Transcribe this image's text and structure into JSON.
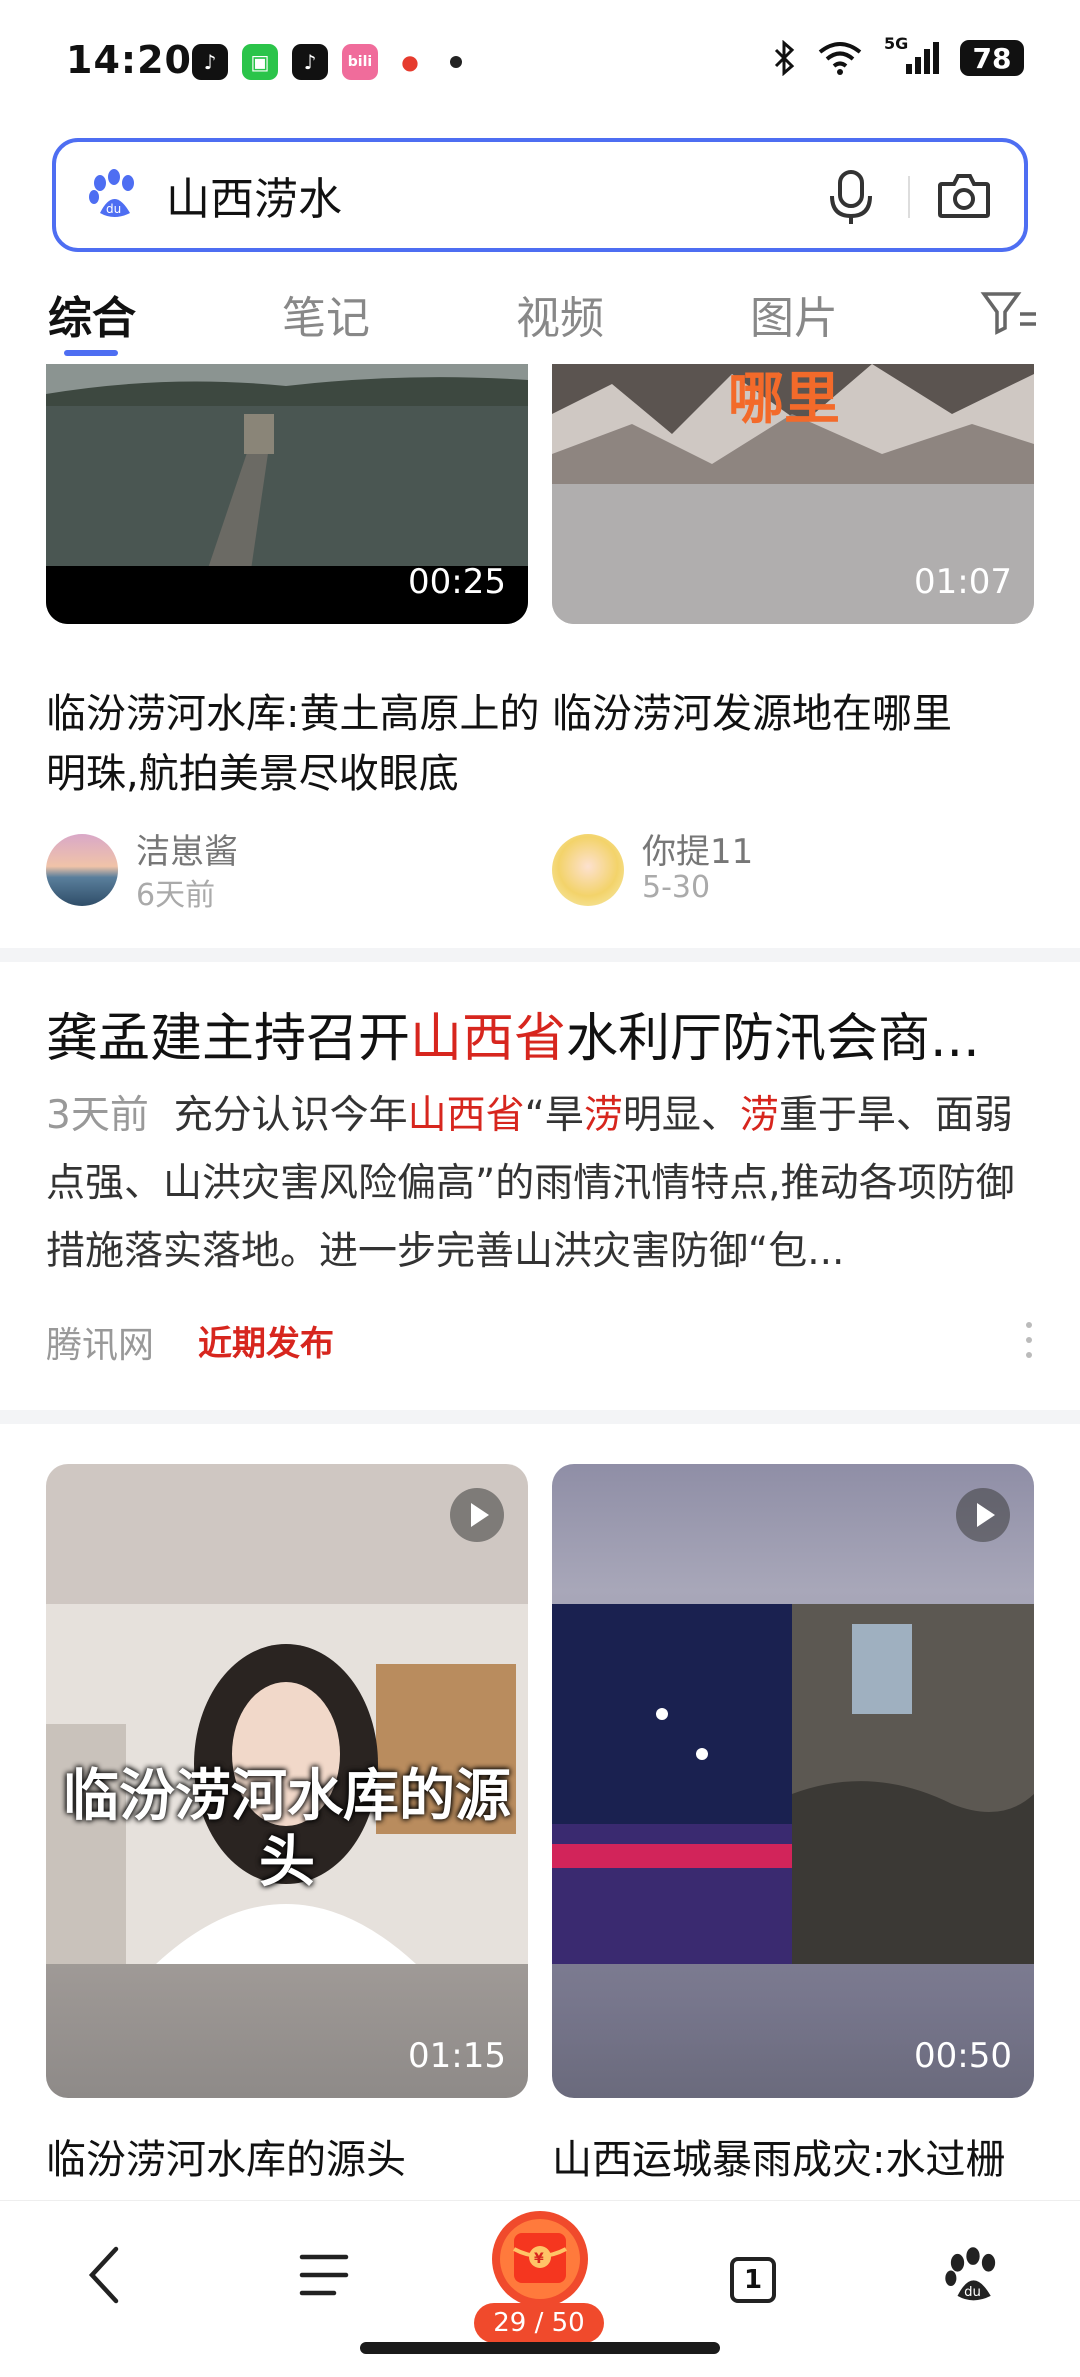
{
  "status_bar": {
    "time": "14:20",
    "battery": "78",
    "network": "5G",
    "apps": [
      "tiktok-icon",
      "messages-icon",
      "tiktok-icon",
      "bilibili-icon",
      "maps-icon"
    ]
  },
  "search": {
    "query": "山西涝水",
    "placeholder": "山西涝水"
  },
  "tabs": [
    {
      "label": "综合",
      "active": true
    },
    {
      "label": "笔记",
      "active": false
    },
    {
      "label": "视频",
      "active": false
    },
    {
      "label": "图片",
      "active": false
    }
  ],
  "video_row_1": [
    {
      "duration": "00:25",
      "title": "临汾涝河水库:黄土高原上的明珠,航拍美景尽收眼底",
      "author": "洁崽酱",
      "time": "6天前"
    },
    {
      "duration": "01:07",
      "overlay_text": "哪里",
      "title": "临汾涝河发源地在哪里",
      "author": "你提11",
      "time": "5-30"
    }
  ],
  "news": {
    "title_pre": "龚孟建主持召开",
    "title_hl": "山西省",
    "title_post": "水利厅防汛会商...",
    "timestamp": "3天前",
    "body_1": "充分认识今年",
    "body_hl_1": "山西省",
    "body_2": "“旱",
    "body_hl_2": "涝",
    "body_3": "明显、",
    "body_hl_3": "涝",
    "body_4": "重于旱、面弱点强、山洪灾害风险偏高”的雨情汛情特点,推动各项防御措施落实落地。进一步完善山洪灾害防御“包...",
    "source": "腾讯网",
    "tag": "近期发布"
  },
  "video_row_2": [
    {
      "duration": "01:15",
      "overlay_text": "临汾涝河水库的源头",
      "title": "临汾涝河水库的源头"
    },
    {
      "duration": "00:50",
      "title": "山西运城暴雨成灾:水过栅"
    }
  ],
  "bottom_nav": {
    "badge": "29 / 50",
    "tabs_count": "1"
  }
}
